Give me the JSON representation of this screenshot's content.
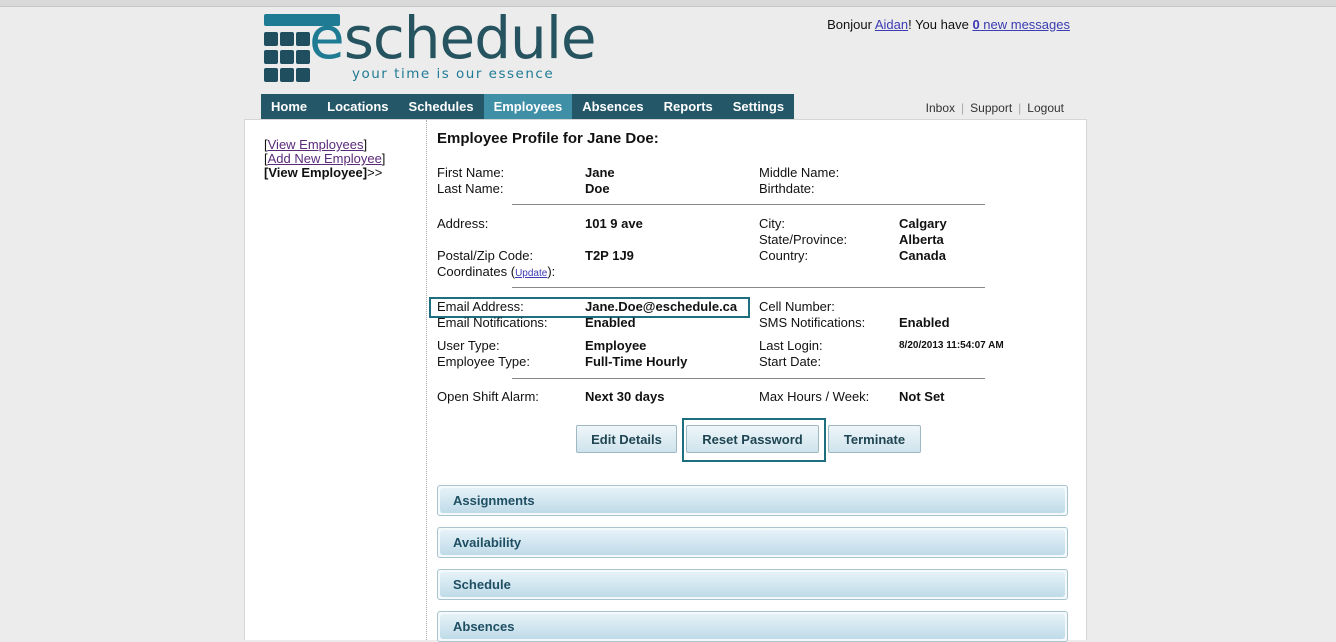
{
  "brand": {
    "name_prefix": "e",
    "name_rest": "schedule",
    "tagline": "your time is our essence"
  },
  "greeting": {
    "prefix": "Bonjour ",
    "user": "Aidan",
    "middle": "! You have ",
    "count": "0",
    "suffix": " new messages"
  },
  "nav": {
    "items": [
      "Home",
      "Locations",
      "Schedules",
      "Employees",
      "Absences",
      "Reports",
      "Settings"
    ],
    "active": "Employees"
  },
  "util_links": [
    "Inbox",
    "Support",
    "Logout"
  ],
  "sidebar": {
    "view_employees": "View Employees",
    "add_new_employee": "Add New Employee",
    "view_employee": "View Employee",
    "arrows": ">>"
  },
  "profile": {
    "title": "Employee Profile for Jane Doe:",
    "first_name_label": "First Name:",
    "first_name": "Jane",
    "last_name_label": "Last Name:",
    "last_name": "Doe",
    "middle_name_label": "Middle Name:",
    "birthdate_label": "Birthdate:",
    "address_label": "Address:",
    "address": "101 9 ave",
    "city_label": "City:",
    "city": "Calgary",
    "state_label": "State/Province:",
    "state": "Alberta",
    "postal_label": "Postal/Zip Code:",
    "postal": "T2P 1J9",
    "country_label": "Country:",
    "country": "Canada",
    "coords_label": "Coordinates",
    "update_link": "Update",
    "email_label": "Email Address:",
    "email": "Jane.Doe@eschedule.ca",
    "cell_label": "Cell Number:",
    "email_notif_label": "Email Notifications:",
    "email_notif": "Enabled",
    "sms_notif_label": "SMS Notifications:",
    "sms_notif": "Enabled",
    "user_type_label": "User Type:",
    "user_type": "Employee",
    "last_login_label": "Last Login:",
    "last_login": "8/20/2013 11:54:07 AM",
    "employee_type_label": "Employee Type:",
    "employee_type": "Full-Time Hourly",
    "start_date_label": "Start Date:",
    "open_shift_label": "Open Shift Alarm:",
    "open_shift": "Next 30 days",
    "max_hours_label": "Max Hours / Week:",
    "max_hours": "Not Set"
  },
  "buttons": {
    "edit": "Edit Details",
    "reset": "Reset Password",
    "terminate": "Terminate"
  },
  "sections": [
    "Assignments",
    "Availability",
    "Schedule",
    "Absences"
  ],
  "colors": {
    "nav_bg": "#245767",
    "nav_active": "#3f8fa7",
    "accent": "#1f7b94",
    "highlight_border": "#1f6e80"
  }
}
